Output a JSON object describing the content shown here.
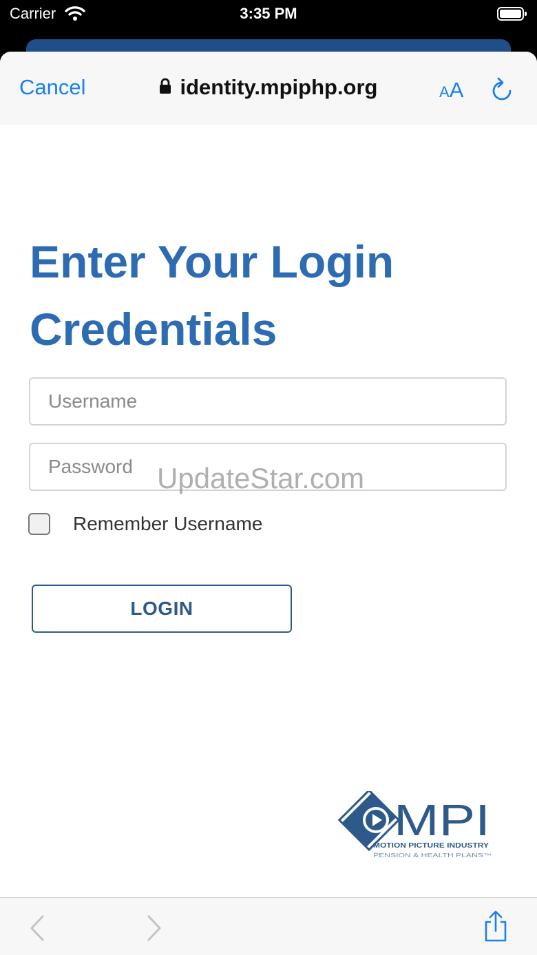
{
  "status_bar": {
    "carrier": "Carrier",
    "time": "3:35 PM"
  },
  "nav_bar": {
    "cancel_label": "Cancel",
    "url": "identity.mpiphp.org",
    "aa_small": "A",
    "aa_large": "A"
  },
  "page": {
    "title": "Enter Your Login Credentials",
    "username_placeholder": "Username",
    "password_placeholder": "Password",
    "remember_label": "Remember Username",
    "login_label": "LOGIN"
  },
  "logo": {
    "mark": "MPI",
    "line1": "MOTION PICTURE INDUSTRY",
    "line2": "PENSION & HEALTH PLANS™"
  },
  "watermark": "UpdateStar.com",
  "colors": {
    "accent": "#1a7ff0",
    "title_blue": "#2d6bb3",
    "button_blue": "#2d5a8a",
    "header_underlay": "#1f4f86"
  },
  "icons": [
    "wifi-icon",
    "battery-icon",
    "lock-icon",
    "text-size-icon",
    "reload-icon",
    "back-icon",
    "forward-icon",
    "share-icon"
  ]
}
